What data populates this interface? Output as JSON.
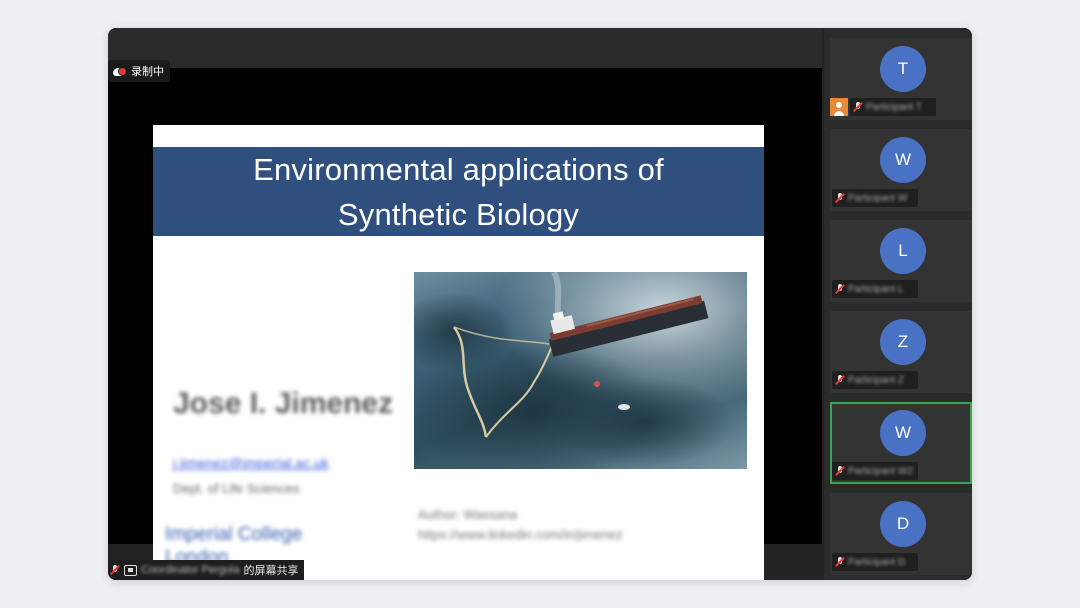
{
  "recording": {
    "label": "录制中"
  },
  "slide": {
    "title_line1": "Environmental applications of",
    "title_line2": "Synthetic Biology",
    "author": "Jose I. Jimenez",
    "email": "j.jimenez@imperial.ac.uk",
    "department": "Dept. of Life Sciences",
    "college_line1": "Imperial College",
    "college_line2": "London",
    "credit_line1": "Author: Wassana",
    "credit_line2": "https://www.linkedin.com/in/jimenez",
    "image_alt": "oil-tanker-spill-photo"
  },
  "share_bar": {
    "presenter_name": "Coordinator Pergola",
    "suffix": "的屏幕共享"
  },
  "participants": [
    {
      "initial": "T",
      "name": "Participant T",
      "host": true,
      "active": false
    },
    {
      "initial": "W",
      "name": "Participant W",
      "host": false,
      "active": false
    },
    {
      "initial": "L",
      "name": "Participant L",
      "host": false,
      "active": false
    },
    {
      "initial": "Z",
      "name": "Participant Z",
      "host": false,
      "active": false
    },
    {
      "initial": "W",
      "name": "Participant W2",
      "host": false,
      "active": true
    },
    {
      "initial": "D",
      "name": "Participant D",
      "host": false,
      "active": false
    }
  ],
  "colors": {
    "title_band": "#2f4f7f",
    "avatar": "#4a72c4",
    "active_outline": "#3fa34d",
    "recording_dot": "#e53935"
  }
}
